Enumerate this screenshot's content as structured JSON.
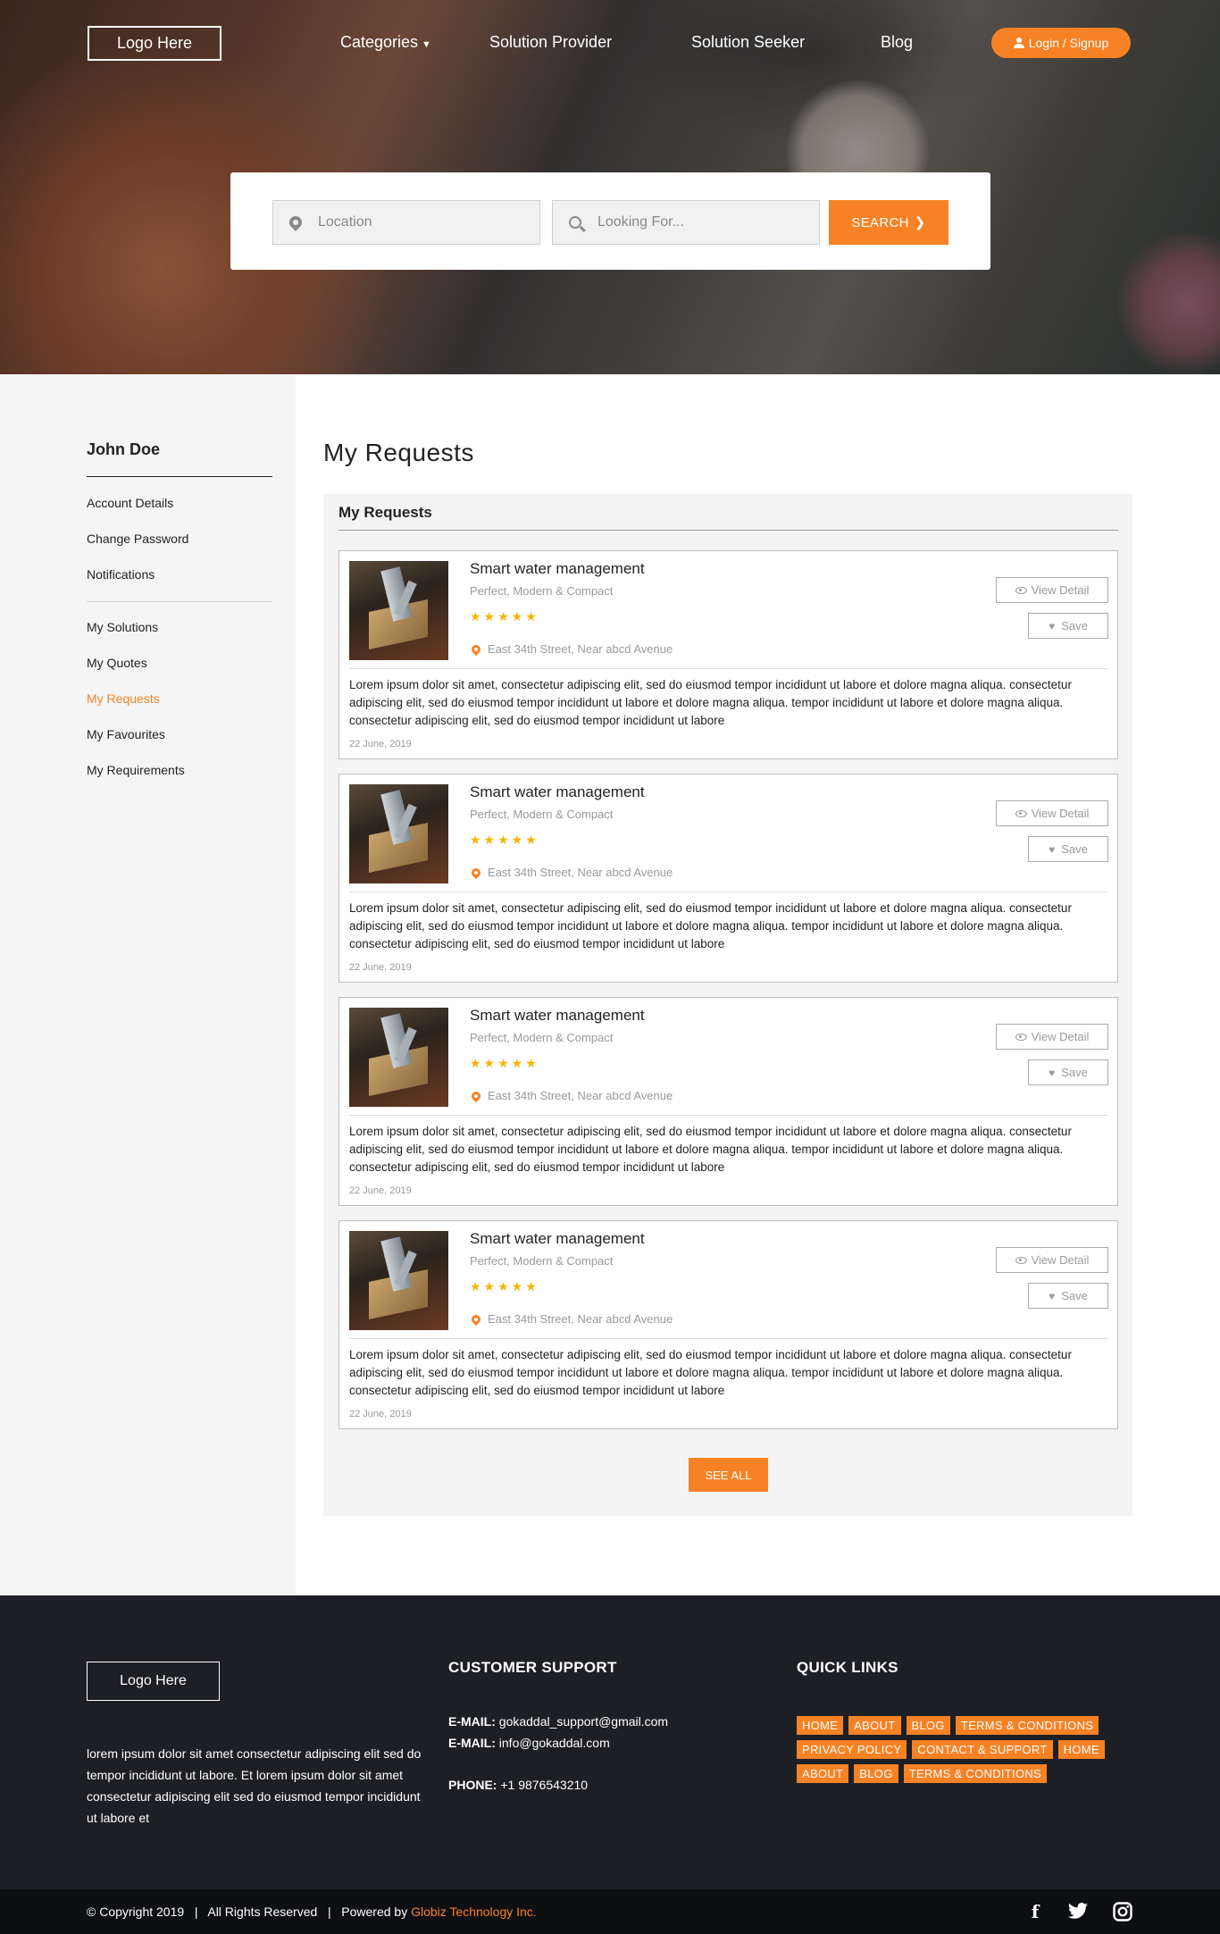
{
  "header": {
    "logo": "Logo Here",
    "nav": [
      "Categories",
      "Solution Provider",
      "Solution Seeker",
      "Blog"
    ],
    "login": "Login / Signup"
  },
  "search": {
    "location_placeholder": "Location",
    "looking_placeholder": "Looking For...",
    "button": "SEARCH"
  },
  "sidebar": {
    "user_name": "John Doe",
    "account_links": [
      "Account Details",
      "Change Password",
      "Notifications"
    ],
    "section_links": [
      "My Solutions",
      "My Quotes",
      "My Requests",
      "My Favourites",
      "My Requirements"
    ],
    "active": "My Requests"
  },
  "main": {
    "page_title": "My Requests",
    "panel_title": "My Requests",
    "see_all": "SEE ALL",
    "cards": [
      {
        "title": "Smart water management",
        "subtitle": "Perfect, Modern & Compact",
        "rating": 5,
        "stars": "★★★★★",
        "location": "East 34th Street, Near abcd Avenue",
        "description": "Lorem ipsum dolor sit amet, consectetur adipiscing elit, sed do eiusmod tempor incididunt ut labore et dolore magna aliqua. consectetur adipiscing elit, sed do eiusmod tempor incididunt ut labore et dolore magna aliqua. tempor incididunt ut labore et dolore magna aliqua. consectetur adipiscing elit, sed do eiusmod tempor incididunt ut labore",
        "date": "22 June, 2019",
        "view_label": "View Detail",
        "save_label": "Save"
      },
      {
        "title": "Smart water management",
        "subtitle": "Perfect, Modern & Compact",
        "rating": 5,
        "stars": "★★★★★",
        "location": "East 34th Street, Near abcd Avenue",
        "description": "Lorem ipsum dolor sit amet, consectetur adipiscing elit, sed do eiusmod tempor incididunt ut labore et dolore magna aliqua. consectetur adipiscing elit, sed do eiusmod tempor incididunt ut labore et dolore magna aliqua. tempor incididunt ut labore et dolore magna aliqua. consectetur adipiscing elit, sed do eiusmod tempor incididunt ut labore",
        "date": "22 June, 2019",
        "view_label": "View Detail",
        "save_label": "Save"
      },
      {
        "title": "Smart water management",
        "subtitle": "Perfect, Modern & Compact",
        "rating": 5,
        "stars": "★★★★★",
        "location": "East 34th Street, Near abcd Avenue",
        "description": "Lorem ipsum dolor sit amet, consectetur adipiscing elit, sed do eiusmod tempor incididunt ut labore et dolore magna aliqua. consectetur adipiscing elit, sed do eiusmod tempor incididunt ut labore et dolore magna aliqua. tempor incididunt ut labore et dolore magna aliqua. consectetur adipiscing elit, sed do eiusmod tempor incididunt ut labore",
        "date": "22 June, 2019",
        "view_label": "View Detail",
        "save_label": "Save"
      },
      {
        "title": "Smart water management",
        "subtitle": "Perfect, Modern & Compact",
        "rating": 5,
        "stars": "★★★★★",
        "location": "East 34th Street, Near abcd Avenue",
        "description": "Lorem ipsum dolor sit amet, consectetur adipiscing elit, sed do eiusmod tempor incididunt ut labore et dolore magna aliqua. consectetur adipiscing elit, sed do eiusmod tempor incididunt ut labore et dolore magna aliqua. tempor incididunt ut labore et dolore magna aliqua. consectetur adipiscing elit, sed do eiusmod tempor incididunt ut labore",
        "date": "22 June, 2019",
        "view_label": "View Detail",
        "save_label": "Save"
      }
    ]
  },
  "footer": {
    "logo": "Logo Here",
    "about": "lorem ipsum dolor sit amet consectetur adipiscing elit sed do tempor incididunt ut labore.  Et lorem ipsum dolor sit amet consectetur adipiscing elit sed do eiusmod tempor incididunt ut labore et",
    "support_heading": "CUSTOMER SUPPORT",
    "email_label": "E-MAIL:",
    "email1": "gokaddal_support@gmail.com",
    "email2": "info@gokaddal.com",
    "phone_label": "PHONE:",
    "phone": "+1 9876543210",
    "links_heading": "QUICK LINKS",
    "links": [
      "HOME",
      "ABOUT",
      "BLOG",
      "TERMS & CONDITIONS",
      "PRIVACY POLICY",
      "CONTACT & SUPPORT",
      "HOME",
      "ABOUT",
      "BLOG",
      "TERMS & CONDITIONS"
    ],
    "copyright": "© Copyright 2019   |   All Rights Reserved   |   Powered by ",
    "powered_by": "Globiz Technology Inc.",
    "social": [
      "facebook-icon",
      "twitter-icon",
      "instagram-icon"
    ]
  },
  "colors": {
    "accent": "#f68225",
    "footer_bg": "#1e1f24",
    "star": "#f7b500"
  }
}
